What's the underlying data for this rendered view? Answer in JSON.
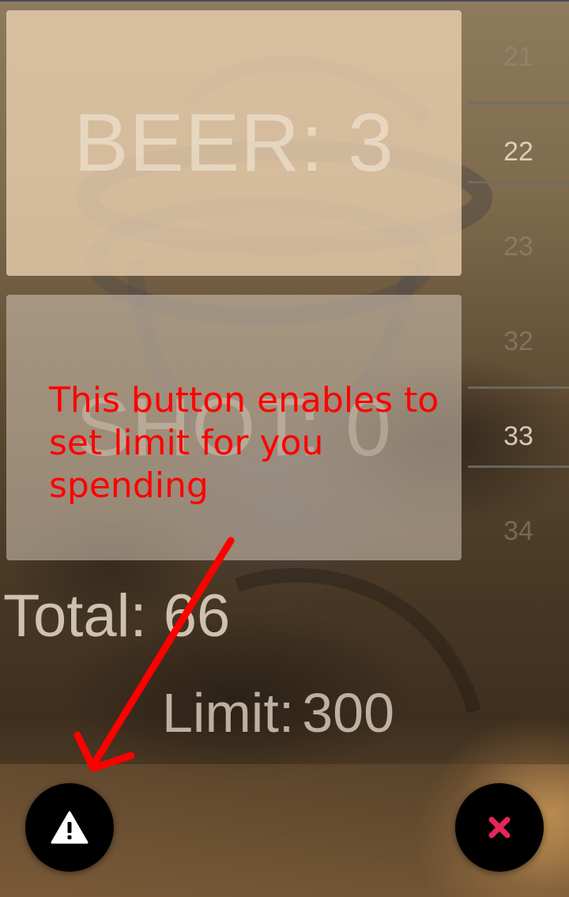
{
  "cards": {
    "beer_label": "BEER: 3",
    "shot_label": "SHOT: 0"
  },
  "picker_top": {
    "values": [
      "21",
      "22",
      "23"
    ],
    "selected": "22"
  },
  "picker_bottom": {
    "values": [
      "32",
      "33",
      "34"
    ],
    "selected": "33"
  },
  "summary": {
    "total_label": "Total:",
    "total_value": "66",
    "limit_label": "Limit:",
    "limit_value": "300"
  },
  "buttons": {
    "set_limit_icon": "warning-icon",
    "reset_icon": "close-icon",
    "reset_icon_color": "#e8245a"
  },
  "annotation": {
    "text": "This button enables to set limit for you spending",
    "color": "#ff0000"
  }
}
